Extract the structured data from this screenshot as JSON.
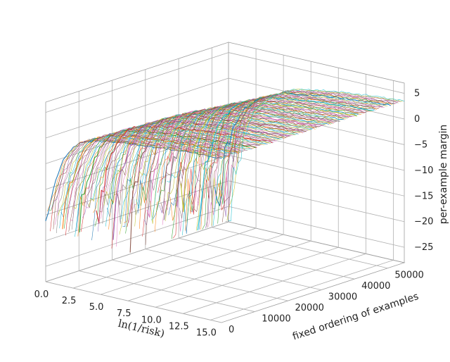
{
  "chart_data": {
    "type": "line3d",
    "title": "",
    "xlabel": "ln(1/risk)",
    "ylabel": "fixed ordering of examples",
    "zlabel": "per-example margin",
    "x_ticks": [
      0.0,
      2.5,
      5.0,
      7.5,
      10.0,
      12.5,
      15.0
    ],
    "y_ticks": [
      0,
      10000,
      20000,
      30000,
      40000,
      50000
    ],
    "z_ticks": [
      -25,
      -20,
      -15,
      -10,
      -5,
      0,
      5
    ],
    "xlim": [
      0,
      16
    ],
    "ylim": [
      0,
      55000
    ],
    "zlim": [
      -28,
      7
    ],
    "n_series_shown": 120,
    "n_series_implied": 50000,
    "series_description": "Each colored curve is one example; x is ln(1/risk), z is its margin. Curves start very negative near x≈0 (down to roughly −27), ramp steeply upward, cross 0 between x≈1 and x≈5, then flatten, converging toward margins in roughly [2, 6] by x≈15. Curves are sorted along y by example index; later examples cross 0 at larger x.",
    "margin_profile_typical": {
      "x": [
        0.0,
        0.5,
        1.0,
        1.5,
        2.0,
        2.5,
        3.0,
        4.0,
        6.0,
        8.0,
        10.0,
        12.5,
        15.5
      ],
      "z_early": [
        -16.0,
        -11.0,
        -7.0,
        -4.0,
        -2.0,
        -0.5,
        0.5,
        1.5,
        2.2,
        2.8,
        3.2,
        3.6,
        4.0
      ],
      "z_mid": [
        -22.0,
        -15.0,
        -10.0,
        -6.5,
        -4.0,
        -2.0,
        -0.5,
        0.8,
        1.8,
        2.4,
        2.9,
        3.3,
        3.8
      ],
      "z_late": [
        -27.0,
        -21.0,
        -15.0,
        -10.0,
        -7.0,
        -5.0,
        -3.5,
        -1.5,
        0.8,
        1.6,
        2.3,
        2.9,
        3.5
      ]
    },
    "colormap": "tab10-cycled"
  }
}
